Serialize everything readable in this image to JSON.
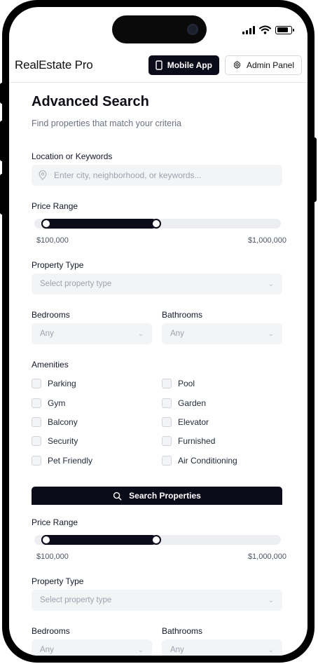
{
  "app": {
    "brand": "RealEstate Pro",
    "mobile_app_label": "Mobile App",
    "admin_panel_label": "Admin Panel"
  },
  "colors": {
    "primary": "#0b0b1a",
    "field_bg": "#f3f4f6",
    "muted_text": "#6b7280",
    "border": "#e5e7eb"
  },
  "search": {
    "title": "Advanced Search",
    "subtitle": "Find properties that match your criteria",
    "location_label": "Location or Keywords",
    "location_placeholder": "Enter city, neighborhood, or keywords...",
    "price_label": "Price Range",
    "price_min": "$100,000",
    "price_max": "$1,000,000",
    "price_range_fraction": [
      0.0,
      0.5
    ],
    "property_type_label": "Property Type",
    "property_type_value": "Select property type",
    "bedrooms_label": "Bedrooms",
    "bedrooms_value": "Any",
    "bathrooms_label": "Bathrooms",
    "bathrooms_value": "Any",
    "amenities_label": "Amenities",
    "amenities": [
      "Parking",
      "Pool",
      "Gym",
      "Garden",
      "Balcony",
      "Elevator",
      "Security",
      "Furnished",
      "Pet Friendly",
      "Air Conditioning"
    ],
    "search_button": "Search Properties"
  },
  "repeat": {
    "price_label": "Price Range",
    "price_min": "$100,000",
    "price_max": "$1,000,000",
    "property_type_label": "Property Type",
    "property_type_value": "Select property type",
    "bedrooms_label": "Bedrooms",
    "bedrooms_value": "Any",
    "bathrooms_label": "Bathrooms",
    "bathrooms_value": "Any"
  },
  "icons": {
    "island": "camera-icon",
    "signal": "signal-icon",
    "wifi": "wifi-icon",
    "battery": "battery-icon",
    "phone": "smartphone-icon",
    "gear": "gear-icon",
    "pin": "map-pin-icon",
    "search": "search-icon",
    "chevron": "chevron-down-icon"
  }
}
